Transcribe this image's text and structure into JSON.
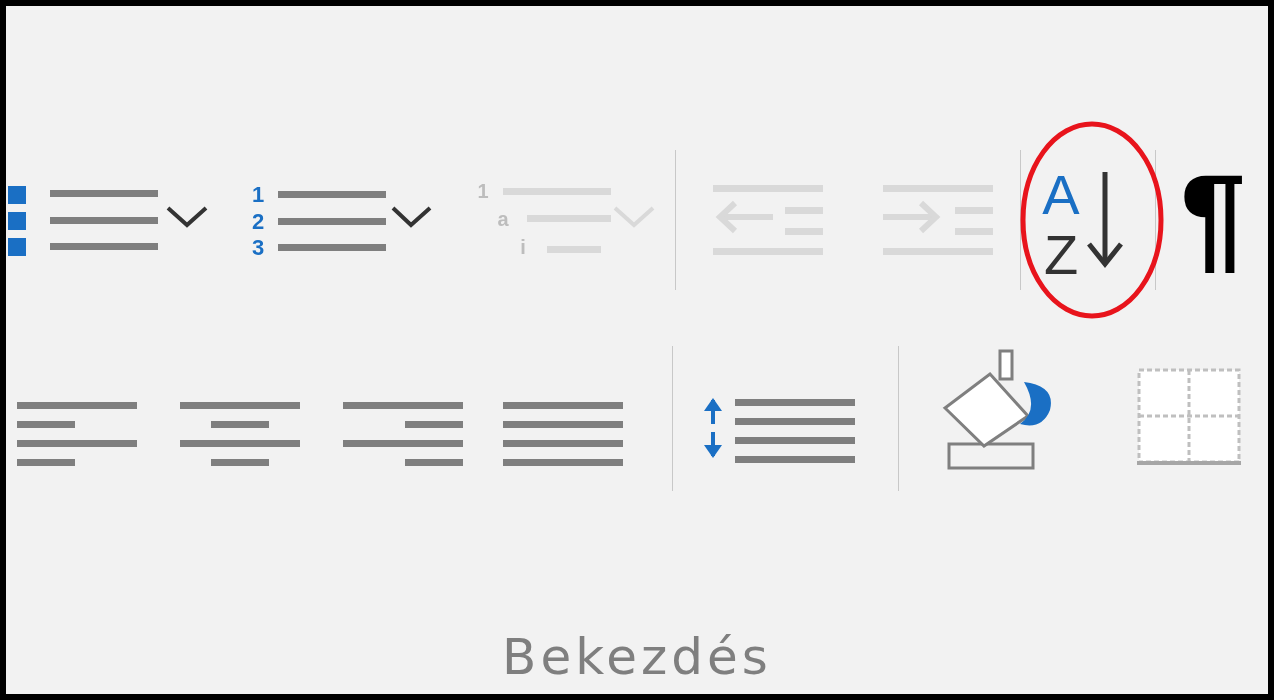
{
  "row1": [
    {
      "kind": "bullets",
      "disabled": false
    },
    {
      "kind": "numbering",
      "glyphs": [
        "1",
        "2",
        "3"
      ],
      "disabled": false
    },
    {
      "kind": "multilevel",
      "glyphs": [
        "1",
        "a",
        "i"
      ],
      "disabled": true
    },
    {
      "kind": "separator"
    },
    {
      "kind": "decrease-indent",
      "disabled": true
    },
    {
      "kind": "increase-indent",
      "disabled": true
    },
    {
      "kind": "separator"
    },
    {
      "kind": "sort",
      "glyphs": [
        "A",
        "Z"
      ],
      "highlighted": true
    },
    {
      "kind": "separator"
    },
    {
      "kind": "pilcrow",
      "glyph": "¶"
    }
  ],
  "row2": [
    {
      "kind": "align-left"
    },
    {
      "kind": "align-center"
    },
    {
      "kind": "align-right"
    },
    {
      "kind": "align-justify"
    },
    {
      "kind": "separator"
    },
    {
      "kind": "line-spacing"
    },
    {
      "kind": "separator"
    },
    {
      "kind": "shading"
    },
    {
      "kind": "borders"
    }
  ],
  "group_label": "Bekezdés"
}
